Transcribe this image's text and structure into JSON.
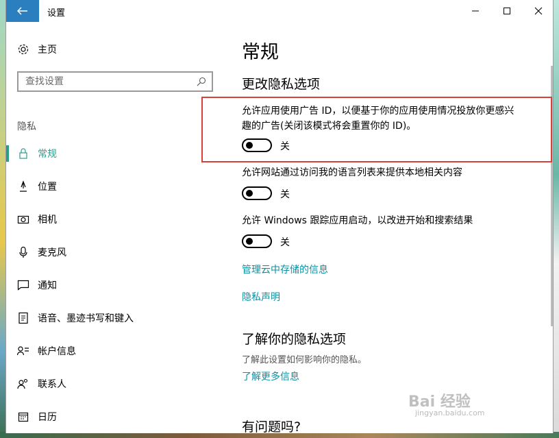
{
  "window": {
    "title": "设置",
    "controls": [
      "minimize-icon",
      "maximize-icon",
      "close-icon"
    ]
  },
  "sidebar": {
    "home_label": "主页",
    "search_placeholder": "查找设置",
    "section_label": "隐私",
    "items": [
      {
        "label": "常规",
        "icon": "lock-icon",
        "selected": true
      },
      {
        "label": "位置",
        "icon": "location-icon"
      },
      {
        "label": "相机",
        "icon": "camera-icon"
      },
      {
        "label": "麦克风",
        "icon": "microphone-icon"
      },
      {
        "label": "通知",
        "icon": "notification-icon"
      },
      {
        "label": "语音、墨迹书写和键入",
        "icon": "speech-icon"
      },
      {
        "label": "帐户信息",
        "icon": "account-icon"
      },
      {
        "label": "联系人",
        "icon": "contacts-icon"
      },
      {
        "label": "日历",
        "icon": "calendar-icon"
      }
    ]
  },
  "main": {
    "title": "常规",
    "subtitle": "更改隐私选项",
    "settings": [
      {
        "line1": "允许应用使用广告 ID，以便基于你的应用使用情况投放你更感兴",
        "line2": "趣的广告(关闭该模式将会重置你的 ID)。",
        "state": "关"
      },
      {
        "line1": "允许网站通过访问我的语言列表来提供本地相关内容",
        "state": "关"
      },
      {
        "line1": "允许 Windows 跟踪应用启动，以改进开始和搜索结果",
        "state": "关"
      }
    ],
    "links": [
      "管理云中存储的信息",
      "隐私声明"
    ],
    "know_title": "了解你的隐私选项",
    "know_desc": "了解此设置如何影响你的隐私。",
    "know_link": "了解更多信息",
    "question_title": "有问题吗?"
  },
  "watermark": {
    "brand": "Bai 经验",
    "url": "jingyan.baidu.com"
  },
  "colors": {
    "accent": "#2a9d8f",
    "link": "#0e8fa0",
    "back_button": "#2b7fbf",
    "highlight": "#d9403a"
  }
}
